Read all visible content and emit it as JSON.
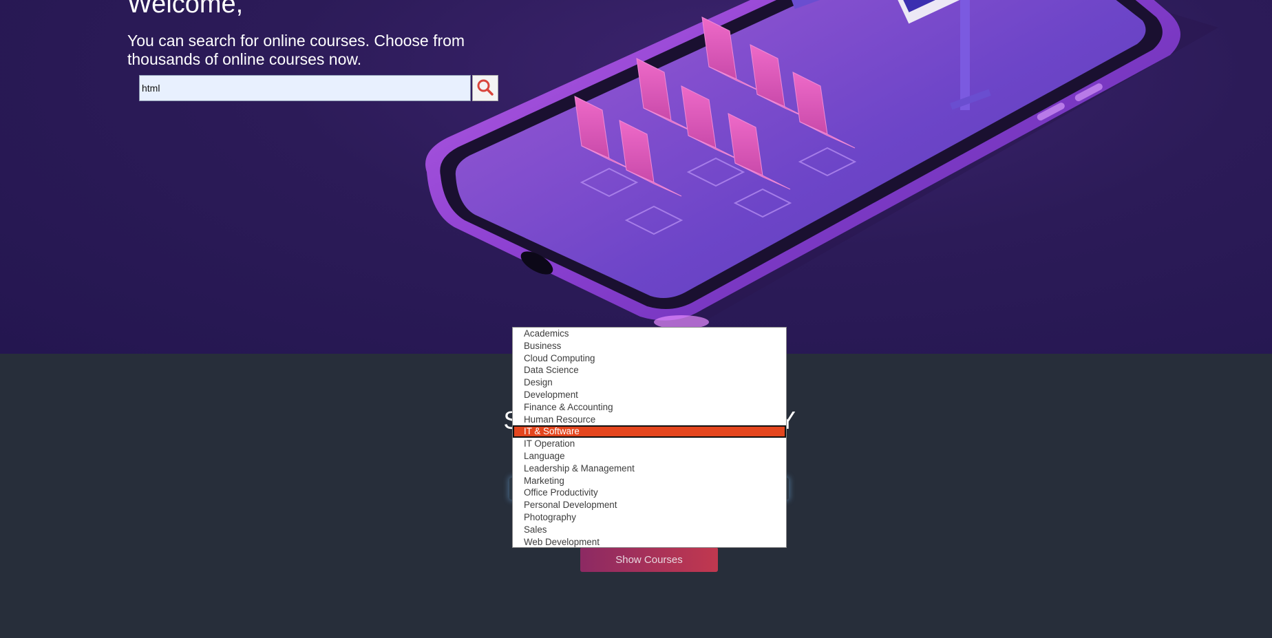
{
  "hero": {
    "welcome": "Welcome,",
    "subtitle": "You can search for online courses. Choose from thousands of online courses now.",
    "search_value": "html",
    "search_icon": "search-icon"
  },
  "category_section": {
    "title": "SEARCH BY CATEGORY",
    "show_button_label": "Show Courses"
  },
  "dropdown": {
    "options": [
      "Academics",
      "Business",
      "Cloud Computing",
      "Data Science",
      "Design",
      "Development",
      "Finance & Accounting",
      "Human Resource",
      "IT & Software",
      "IT Operation",
      "Language",
      "Leadership & Management",
      "Marketing",
      "Office Productivity",
      "Personal Development",
      "Photography",
      "Sales",
      "Web Development"
    ],
    "selected": "IT & Software"
  },
  "colors": {
    "hero_bg": "#2c1b58",
    "section_bg": "#272e3a",
    "selected_option": "#e4461e",
    "button_gradient_start": "#8c2a63",
    "button_gradient_end": "#c1384f"
  }
}
